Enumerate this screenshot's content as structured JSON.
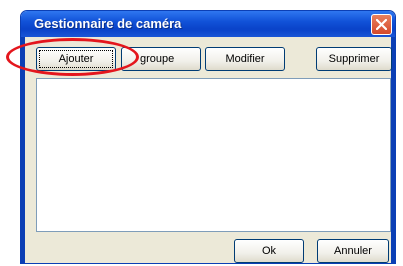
{
  "window": {
    "title": "Gestionnaire de caméra"
  },
  "toolbar": {
    "add_label": "Ajouter",
    "group_label": "groupe",
    "modify_label": "Modifier",
    "delete_label": "Supprimer"
  },
  "camera_list": {
    "items": []
  },
  "footer": {
    "ok_label": "Ok",
    "cancel_label": "Annuler"
  },
  "icons": {
    "close": "close-icon"
  },
  "colors": {
    "titlebar": "#0a43c9",
    "close_button": "#d5492b",
    "annotation": "#e4161d",
    "dialog_background": "#ece9d8"
  }
}
